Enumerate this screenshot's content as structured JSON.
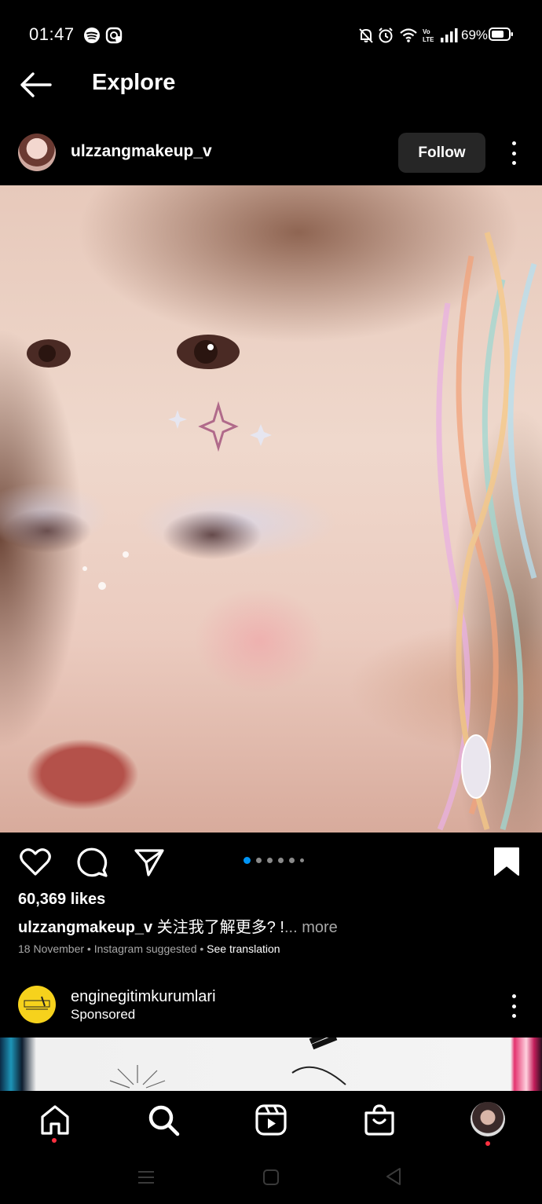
{
  "status_bar": {
    "time": "01:47",
    "battery": "69%",
    "icons": [
      "spotify-icon",
      "app-notification-icon",
      "mute-icon",
      "alarm-icon",
      "wifi-icon",
      "volte-icon",
      "signal-icon",
      "battery-icon"
    ]
  },
  "header": {
    "title": "Explore",
    "back_icon": "arrow-left-icon"
  },
  "post": {
    "username": "ulzzangmakeup_v",
    "follow_label": "Follow",
    "likes": "60,369 likes",
    "caption_user": "ulzzangmakeup_v",
    "caption_text": " 关注我了解更多? !",
    "caption_more": "... more",
    "date": "18 November",
    "source": "Instagram suggested",
    "see_translation": "See translation",
    "carousel": {
      "total": 6,
      "active": 1
    }
  },
  "sponsored_post": {
    "username": "enginegitimkurumlari",
    "sponsored_label": "Sponsored"
  },
  "bottom_nav": {
    "items": [
      "home-icon",
      "search-icon",
      "reels-icon",
      "shop-icon",
      "profile-avatar"
    ]
  },
  "colors": {
    "background": "#000000",
    "accent": "#0095f6",
    "notification": "#ff3040",
    "button_bg": "#262626"
  }
}
